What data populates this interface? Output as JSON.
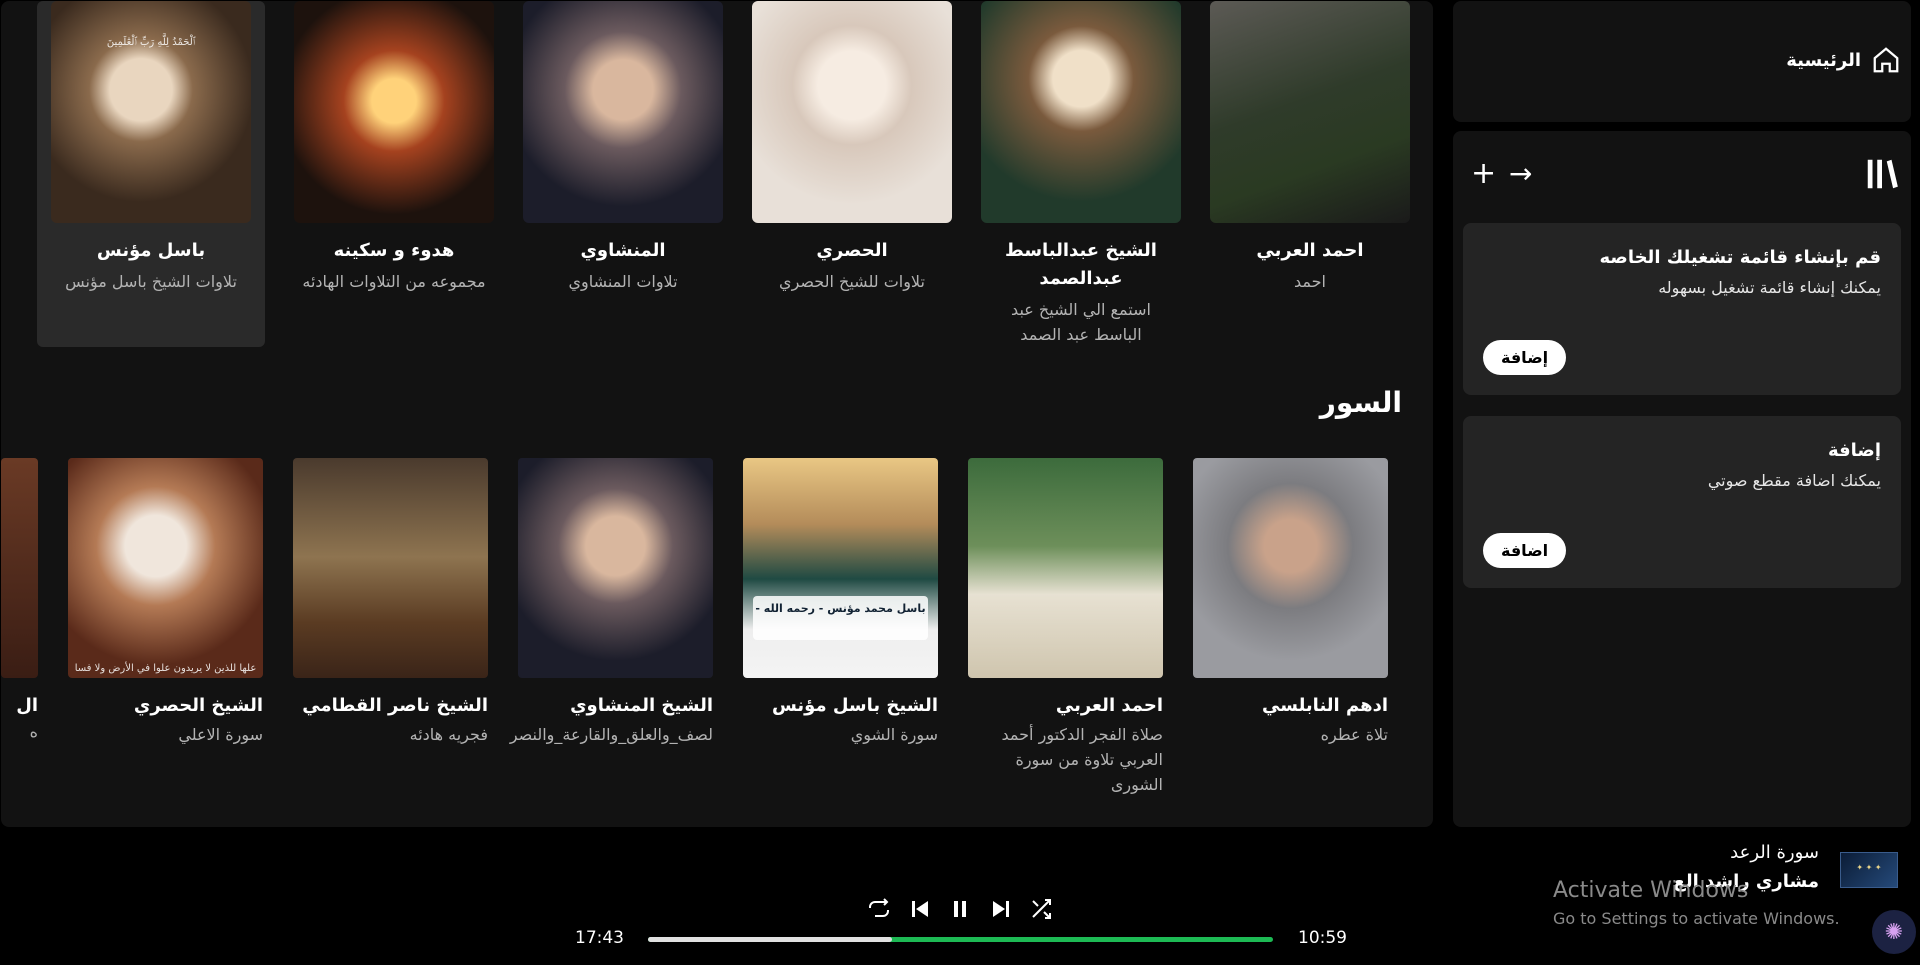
{
  "top_row": [
    {
      "title": "احمد العربي",
      "subtitle": "احمد",
      "art": "a6"
    },
    {
      "title": "الشيخ عبدالباسط عبدالصمد",
      "subtitle": "استمع الي الشيخ عبد الباسط عبد الصمد",
      "art": "a2"
    },
    {
      "title": "الحصري",
      "subtitle": "تلاوات للشيخ الحصري",
      "art": "a3"
    },
    {
      "title": "المنشاوي",
      "subtitle": "تلاوات المنشاوي",
      "art": "a4"
    },
    {
      "title": "هدوء و سكينه",
      "subtitle": "مجموعه من التلاوات الهادئه",
      "art": "a5"
    },
    {
      "title": "باسل مؤنس",
      "subtitle": "تلاوات الشيخ باسل مؤنس",
      "art": "a1",
      "overlay": "ﭐﻟْﺤَﻤْﺪُ ﻟِﻠَّﻪِ ﺭَﺏِّ ﭐﻟْﻌَٰﻠَﻤِﻴﻦَ"
    }
  ],
  "section": {
    "title": "السور"
  },
  "bottom_row": [
    {
      "title": "ادهم النابلسي",
      "subtitle": "تلاة عطره",
      "art": "b1"
    },
    {
      "title": "احمد العربي",
      "subtitle": "صلاة الفجر الدكتور أحمد العربي تلاوة من سورة الشورى",
      "art": "b2"
    },
    {
      "title": "الشيخ باسل مؤنس",
      "subtitle": "سورة الشوي",
      "art": "b3",
      "overlay": "باسل محمد مؤنس - رحمه الله -"
    },
    {
      "title": "الشيخ المنشاوي",
      "subtitle": "لصف_والعلق_والقارعة_والنصر",
      "art": "b4"
    },
    {
      "title": "الشيخ ناصر القطامي",
      "subtitle": "فجريه هادئه",
      "art": "b5"
    },
    {
      "title": "الشيخ الحصري",
      "subtitle": "سورة الاعلي",
      "art": "b6",
      "overlay": "علها للذين لا يريدون علوا في الأرض ولا فسا"
    }
  ],
  "partial_card": {
    "title": "ال",
    "subtitle": "ه"
  },
  "sidebar": {
    "home_label": "الرئيسية",
    "box1": {
      "heading": "قم بإنشاء قائمة تشغيلك الخاصه",
      "text": "يمكنك إنشاء قائمة تشغيل بسهوله",
      "button": "إضافة"
    },
    "box2": {
      "heading": "إضافة",
      "text": "يمكنك اضافة مقطع صوتي",
      "button": "اضافة"
    }
  },
  "player": {
    "track_title": "سورة الرعد",
    "artist": "مشاري راشد الع",
    "elapsed": "10:59",
    "duration": "17:43",
    "progress": 0.39
  },
  "overlay_notice": {
    "line1": "Activate Windows",
    "line2": "Go to Settings to activate Windows."
  },
  "colors": {
    "accent": "#1db954",
    "panel": "#121212",
    "box": "#242424"
  }
}
